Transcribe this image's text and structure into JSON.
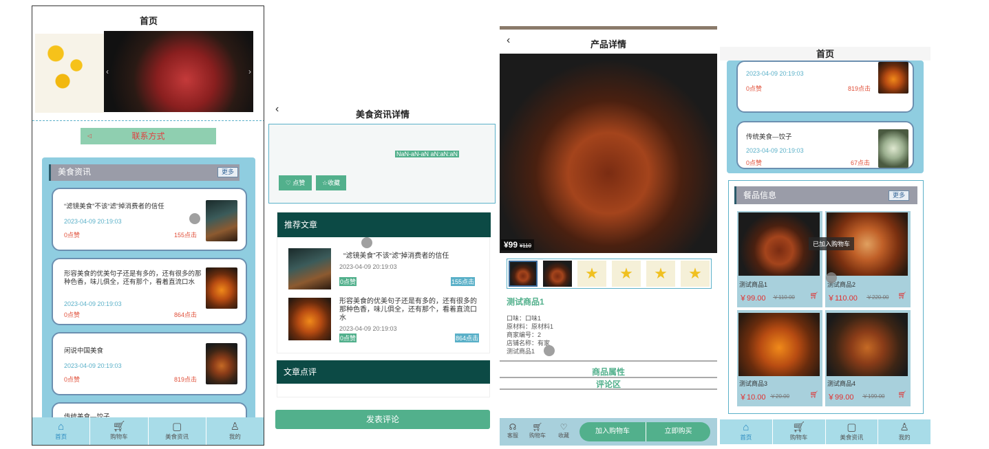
{
  "colors": {
    "accent": "#5ab0c8",
    "teal_dark": "#0c4a45",
    "green": "#52b08c",
    "price": "#e03030"
  },
  "screen1": {
    "title": "首页",
    "contact_label": "联系方式",
    "news_header": "美食资讯",
    "more_label": "更多",
    "articles": [
      {
        "title": "“滤镜美食”不该“滤”掉消费者的信任",
        "date": "2023-04-09 20:19:03",
        "likes": "0点赞",
        "clicks": "155点击"
      },
      {
        "title": "形容美食的优美句子还是有多的，还有很多的那种色香，味儿俱全，还有那个，看着直流口水",
        "date": "2023-04-09 20:19:03",
        "likes": "0点赞",
        "clicks": "864点击"
      },
      {
        "title": "闲说中国美食",
        "date": "2023-04-09 20:19:03",
        "likes": "0点赞",
        "clicks": "819点击"
      },
      {
        "title": "传统美食—饺子"
      }
    ],
    "tabs": [
      {
        "label": "首页",
        "icon": "home-icon"
      },
      {
        "label": "购物车",
        "icon": "cart-icon"
      },
      {
        "label": "美食资讯",
        "icon": "news-icon"
      },
      {
        "label": "我的",
        "icon": "user-icon"
      }
    ]
  },
  "screen2": {
    "title": "美食资讯详情",
    "date_text": "NaN-aN-aN aN:aN:aN",
    "like_label": "点赞",
    "fav_label": "收藏",
    "recommend_header": "推荐文章",
    "recommend": [
      {
        "title": "“滤镜美食”不该“滤”掉消费者的信任",
        "date": "2023-04-09 20:19:03",
        "likes": "0点赞",
        "clicks": "155点击"
      },
      {
        "title": "形容美食的优美句子还是有多的，还有很多的那种色香，味儿俱全，还有那个，看着直流口水",
        "date": "2023-04-09 20:19:03",
        "likes": "0点赞",
        "clicks": "864点击"
      }
    ],
    "comment_header": "文章点评",
    "post_label": "发表评论"
  },
  "screen3": {
    "title": "产品详情",
    "price": "¥99",
    "old_price": "¥110",
    "product_name": "测试商品1",
    "attrs": [
      "口味：口味1",
      "原材料：原材料1",
      "商家编号：2",
      "店铺名称：有家",
      "测试商品1"
    ],
    "section_attr": "商品属性",
    "section_comment": "评论区",
    "bottom": {
      "service": "客服",
      "cart": "购物车",
      "fav": "收藏",
      "add_cart": "加入购物车",
      "buy": "立即购买"
    }
  },
  "screen4": {
    "title": "首页",
    "articles": [
      {
        "title": "闲说中国美食",
        "date": "2023-04-09 20:19:03",
        "likes": "0点赞",
        "clicks": "819点击"
      },
      {
        "title": "传统美食—饺子",
        "date": "2023-04-09 20:19:03",
        "likes": "0点赞",
        "clicks": "67点击"
      }
    ],
    "goods_header": "餐品信息",
    "more_label": "更多",
    "toast": "已加入购物车",
    "goods": [
      {
        "name": "测试商品1",
        "price": "￥99.00",
        "old": "￥110.00"
      },
      {
        "name": "测试商品2",
        "price": "￥110.00",
        "old": "￥220.00"
      },
      {
        "name": "测试商品3",
        "price": "￥10.00",
        "old": "￥20.00"
      },
      {
        "name": "测试商品4",
        "price": "￥99.00",
        "old": "￥199.00"
      }
    ],
    "tabs": [
      {
        "label": "首页"
      },
      {
        "label": "购物车"
      },
      {
        "label": "美食资讯"
      },
      {
        "label": "我的"
      }
    ]
  }
}
